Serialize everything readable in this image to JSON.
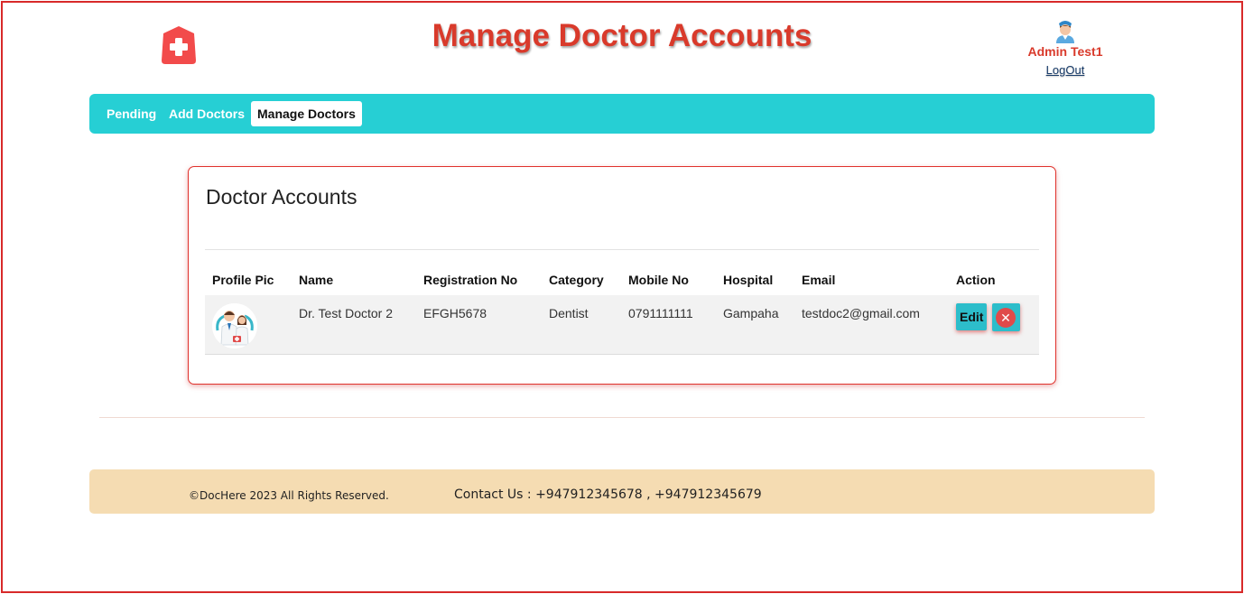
{
  "header": {
    "title": "Manage Doctor Accounts",
    "logo_icon": "medical-cross-icon",
    "brand_color": "#f24b4b",
    "user": {
      "name": "Admin Test1",
      "logout_label": "LogOut",
      "avatar_icon": "nurse-avatar-icon"
    }
  },
  "nav": {
    "items": [
      {
        "label": "Pending",
        "active": false
      },
      {
        "label": "Add Doctors",
        "active": false
      },
      {
        "label": "Manage Doctors",
        "active": true
      }
    ],
    "bg_color": "#26cfd4"
  },
  "card": {
    "title": "Doctor Accounts",
    "columns": [
      "Profile Pic",
      "Name",
      "Registration No",
      "Category",
      "Mobile No",
      "Hospital",
      "Email",
      "Action"
    ],
    "rows": [
      {
        "profile_pic_icon": "doctors-illustration",
        "name": "Dr. Test Doctor 2",
        "registration_no": "EFGH5678",
        "category": "Dentist",
        "mobile_no": "0791111111",
        "hospital": "Gampaha",
        "email": "testdoc2@gmail.com",
        "edit_label": "Edit",
        "delete_icon": "close-circle-icon"
      }
    ]
  },
  "footer": {
    "copyright": "©DocHere 2023 All Rights Reserved.",
    "contact": "Contact Us : +947912345678 , +947912345679",
    "bg_color": "#f5dcb2"
  }
}
